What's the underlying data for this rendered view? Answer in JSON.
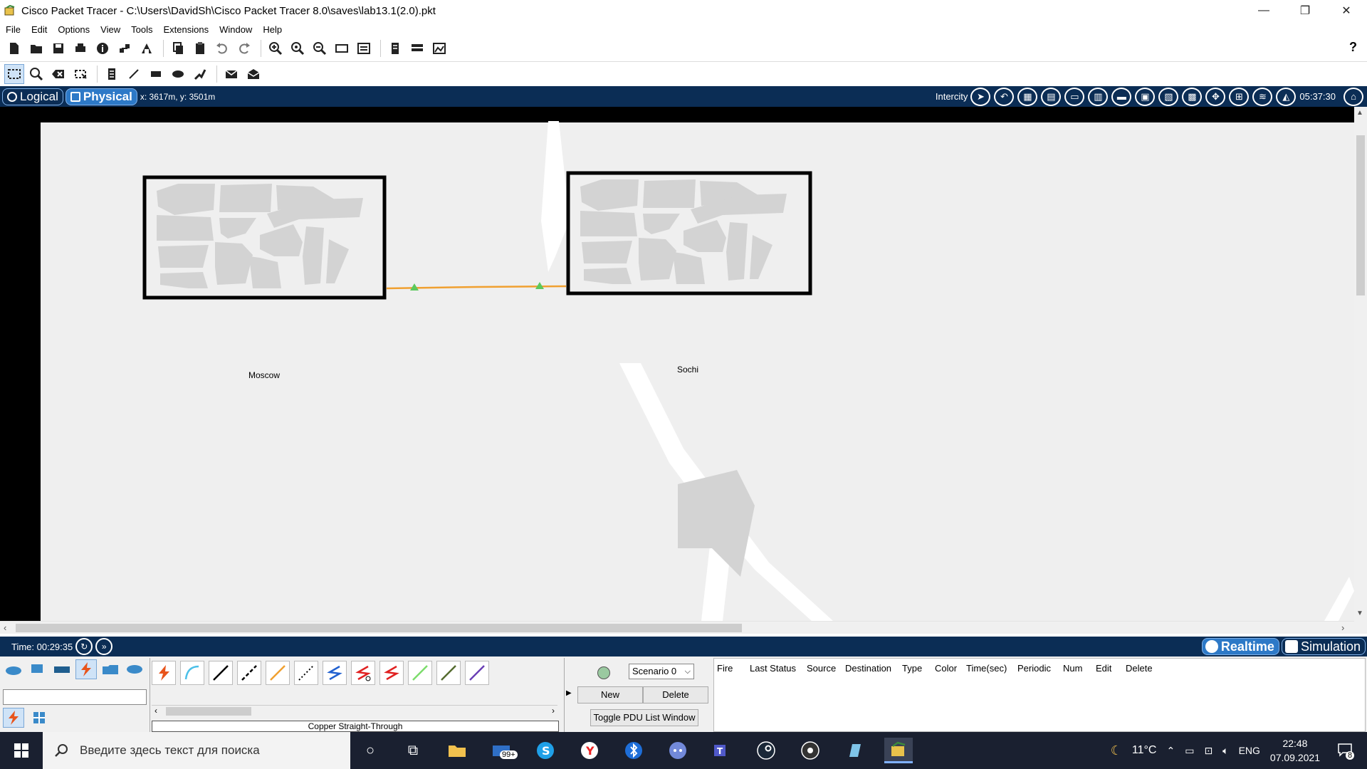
{
  "window": {
    "title": "Cisco Packet Tracer - C:\\Users\\DavidSh\\Cisco Packet Tracer 8.0\\saves\\lab13.1(2.0).pkt",
    "minimize": "—",
    "restore": "❐",
    "close": "✕"
  },
  "menu": [
    "File",
    "Edit",
    "Options",
    "View",
    "Tools",
    "Extensions",
    "Window",
    "Help"
  ],
  "toolbar": {
    "help": "?"
  },
  "modebar": {
    "logical": "Logical",
    "physical": "Physical",
    "coords": "x: 3617m, y: 3501m",
    "intercity": "Intercity",
    "clock": "05:37:30"
  },
  "workspace": {
    "cities": [
      {
        "name": "Moscow"
      },
      {
        "name": "Sochi"
      }
    ],
    "link_color": "#f0a030",
    "link_light_color": "#5cc85c"
  },
  "timebar": {
    "time": "Time: 00:29:35",
    "realtime": "Realtime",
    "simulation": "Simulation"
  },
  "bottom": {
    "connection_name": "Copper Straight-Through",
    "scenario": "Scenario 0",
    "new_button": "New",
    "delete_button": "Delete",
    "toggle_button": "Toggle PDU List Window",
    "pdu_headers": [
      "Fire",
      "Last Status",
      "Source",
      "Destination",
      "Type",
      "Color",
      "Time(sec)",
      "Periodic",
      "Num",
      "Edit",
      "Delete"
    ]
  },
  "taskbar": {
    "search_placeholder": "Введите здесь текст для поиска",
    "mail_badge": "99+",
    "weather": "11°C",
    "language": "ENG",
    "time": "22:48",
    "date": "07.09.2021",
    "notifications": "8"
  },
  "colors": {
    "accent": "#0b2d55",
    "active_tab": "#2d79c7"
  }
}
